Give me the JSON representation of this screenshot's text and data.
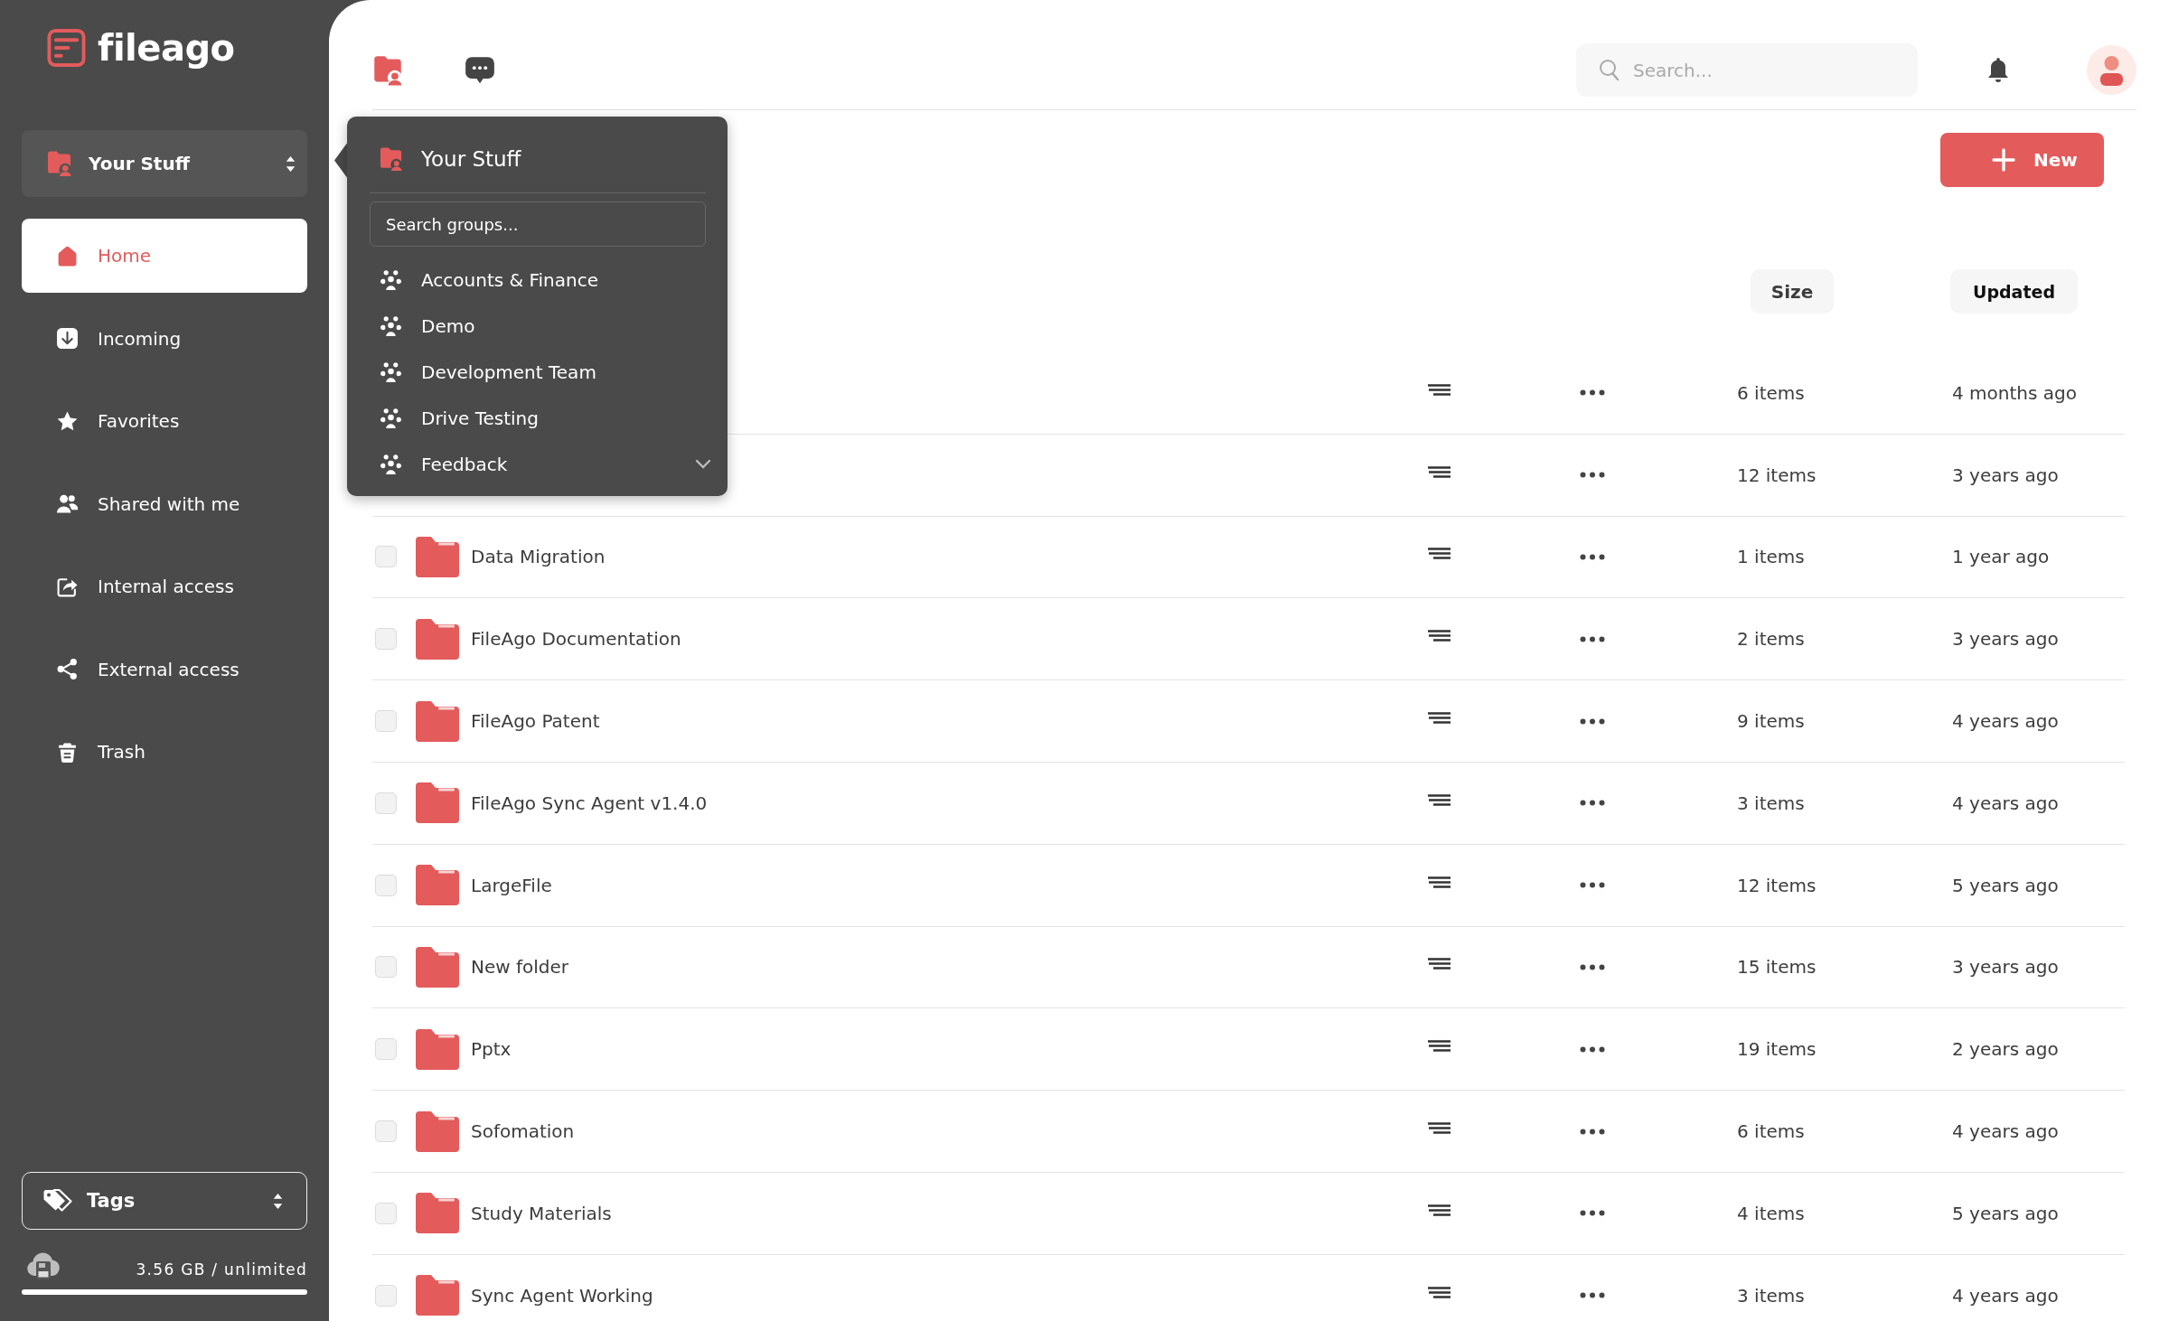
{
  "sidebar": {
    "logo": "fileago",
    "space_selector": {
      "label": "Your Stuff"
    },
    "nav": [
      {
        "label": "Home",
        "selected": true
      },
      {
        "label": "Incoming",
        "selected": false
      },
      {
        "label": "Favorites",
        "selected": false
      },
      {
        "label": "Shared with me",
        "selected": false
      },
      {
        "label": "Internal access",
        "selected": false
      },
      {
        "label": "External access",
        "selected": false
      },
      {
        "label": "Trash",
        "selected": false
      }
    ],
    "tags": {
      "label": "Tags"
    },
    "storage": {
      "text": "3.56 GB / unlimited"
    }
  },
  "topbar": {
    "views": [
      {
        "selected": true
      },
      {
        "selected": false
      }
    ],
    "search": {
      "placeholder": "Search..."
    }
  },
  "toolbar": {
    "new_button": "New"
  },
  "table": {
    "columns": [
      {
        "label": "Size"
      },
      {
        "label": "Updated"
      }
    ],
    "rows": [
      {
        "size": "6 items",
        "updated": "4 months ago"
      },
      {
        "size": "12 items",
        "updated": "3 years ago"
      },
      {
        "name": "Data Migration",
        "checked": false,
        "size": "1 items",
        "updated": "1 year ago"
      },
      {
        "name": "FileAgo Documentation",
        "checked": false,
        "size": "2 items",
        "updated": "3 years ago"
      },
      {
        "name": "FileAgo Patent",
        "checked": false,
        "size": "9 items",
        "updated": "4 years ago"
      },
      {
        "name": "FileAgo Sync Agent v1.4.0",
        "checked": false,
        "size": "3 items",
        "updated": "4 years ago"
      },
      {
        "name": "LargeFile",
        "checked": false,
        "size": "12 items",
        "updated": "5 years ago"
      },
      {
        "name": "New folder",
        "checked": false,
        "size": "15 items",
        "updated": "3 years ago"
      },
      {
        "name": "Pptx",
        "checked": false,
        "size": "19 items",
        "updated": "2 years ago"
      },
      {
        "name": "Sofomation",
        "checked": false,
        "size": "6 items",
        "updated": "4 years ago"
      },
      {
        "name": "Study Materials",
        "checked": false,
        "size": "4 items",
        "updated": "5 years ago"
      },
      {
        "name": "Sync Agent Working",
        "checked": false,
        "size": "3 items",
        "updated": "4 years ago"
      }
    ]
  },
  "groups_popup": {
    "title": "Your Stuff",
    "search": {
      "placeholder": "Search groups..."
    },
    "groups": [
      {
        "label": "Accounts & Finance"
      },
      {
        "label": "Demo"
      },
      {
        "label": "Development Team"
      },
      {
        "label": "Drive Testing"
      },
      {
        "label": "Feedback"
      }
    ],
    "more_below": true
  }
}
